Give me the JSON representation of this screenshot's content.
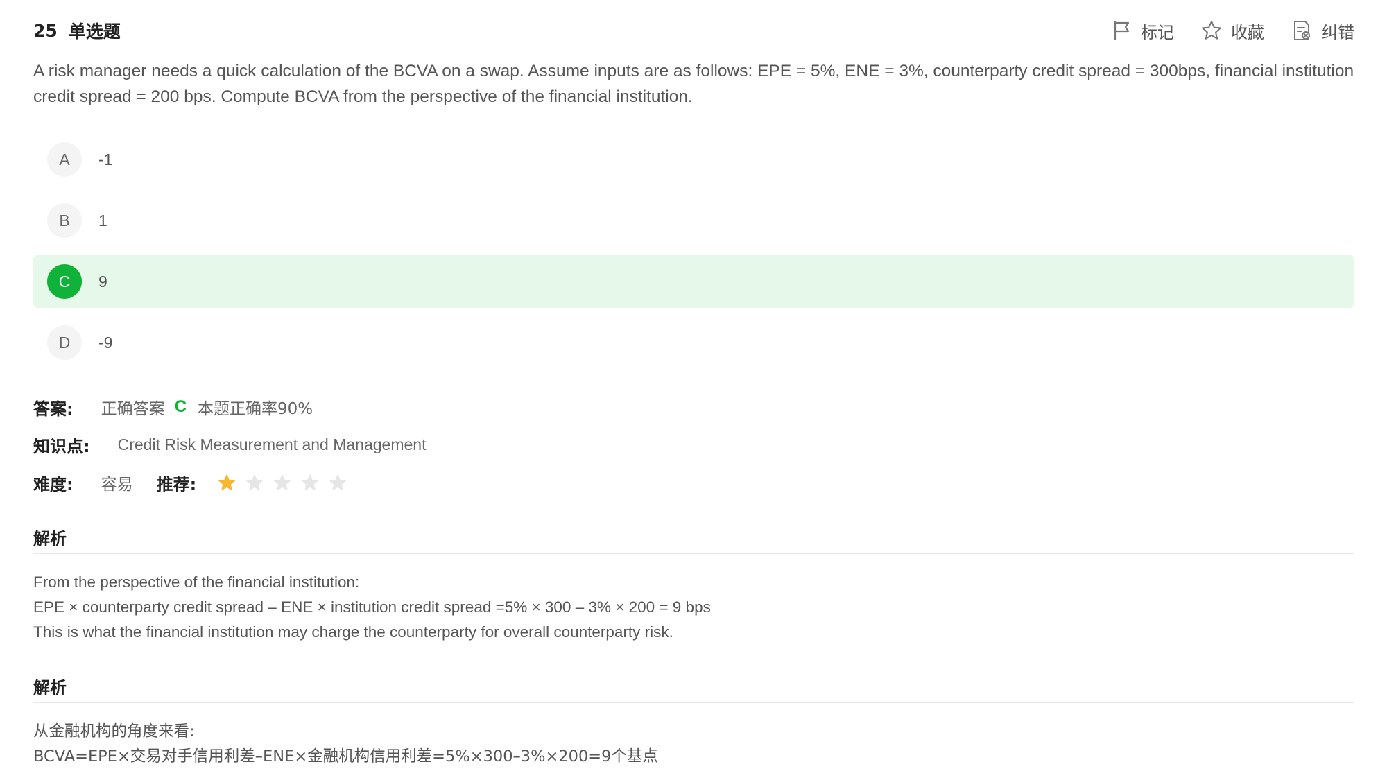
{
  "question": {
    "number": "25",
    "type": "单选题",
    "text": "A risk manager needs a quick calculation of the BCVA on a swap. Assume inputs are as follows: EPE = 5%, ENE = 3%, counterparty credit spread = 300bps, financial institution credit spread = 200 bps. Compute BCVA from the perspective of the financial institution."
  },
  "toolbar": {
    "mark_label": "标记",
    "favorite_label": "收藏",
    "report_label": "纠错"
  },
  "options": [
    {
      "letter": "A",
      "text": "-1"
    },
    {
      "letter": "B",
      "text": "1"
    },
    {
      "letter": "C",
      "text": "9"
    },
    {
      "letter": "D",
      "text": "-9"
    }
  ],
  "answer": {
    "label": "答案:",
    "correct_prefix": "正确答案",
    "correct_letter": "C",
    "accuracy_text": "本题正确率90%"
  },
  "knowledge": {
    "label": "知识点:",
    "value": "Credit Risk Measurement and Management"
  },
  "difficulty": {
    "label": "难度:",
    "value": "容易",
    "recommend_label": "推荐:",
    "rating": 1,
    "max_rating": 5
  },
  "analysis_en": {
    "title": "解析",
    "lines": [
      "From the perspective of the financial institution:",
      "EPE × counterparty credit spread – ENE × institution credit spread =5% × 300 – 3% × 200 = 9 bps",
      "This is what the financial institution may charge the counterparty for overall counterparty risk."
    ]
  },
  "analysis_cn": {
    "title": "解析",
    "lines": [
      "从金融机构的角度来看:",
      "BCVA=EPE×交易对手信用利差–ENE×金融机构信用利差=5%×300–3%×200=9个基点"
    ]
  },
  "colors": {
    "correct_green": "#11b23a",
    "correct_bg": "#e6f8e9",
    "star_filled": "#f5b82e",
    "star_empty": "#e6e6e6"
  }
}
